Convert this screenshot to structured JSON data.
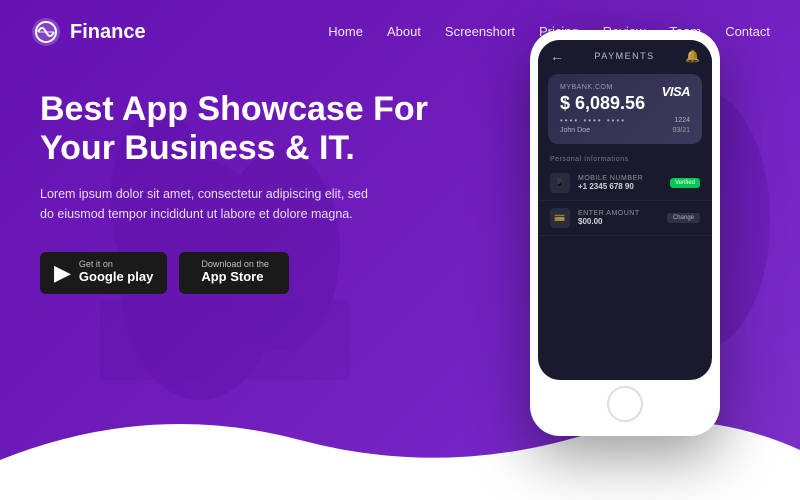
{
  "brand": {
    "name": "Finance",
    "logo_icon": "🌐"
  },
  "nav": {
    "links": [
      {
        "label": "Home",
        "href": "#"
      },
      {
        "label": "About",
        "href": "#"
      },
      {
        "label": "Screenshort",
        "href": "#"
      },
      {
        "label": "Pricing",
        "href": "#"
      },
      {
        "label": "Review",
        "href": "#"
      },
      {
        "label": "Team",
        "href": "#"
      },
      {
        "label": "Contact",
        "href": "#"
      }
    ]
  },
  "hero": {
    "title": "Best App Showcase For Your Business & IT.",
    "subtitle": "Lorem ipsum dolor sit amet, consectetur adipiscing elit, sed do eiusmod tempor incididunt ut labore et dolore magna.",
    "cta_google_pre": "Get it on",
    "cta_google": "Google play",
    "cta_apple_pre": "Download on the",
    "cta_apple": "App Store"
  },
  "phone": {
    "topbar_title": "PAYMENTS",
    "card": {
      "balance_label": "myBank.com",
      "amount": "$ 6,089.56",
      "dots": "•••• •••• ••••",
      "card_number": "1224",
      "name": "John Doe",
      "expiry": "03/21",
      "brand": "VISA"
    },
    "section_label": "Personal Informations",
    "rows": [
      {
        "icon": "📱",
        "label": "MOBILE NUMBER",
        "value": "+1 2345 678 90",
        "badge": "Verified"
      },
      {
        "icon": "💳",
        "label": "ENTER AMOUNT",
        "value": "$00.00",
        "action": "Change"
      }
    ]
  },
  "colors": {
    "primary": "#7c3aed",
    "dark": "#4c1d95",
    "accent": "#a855f7"
  }
}
